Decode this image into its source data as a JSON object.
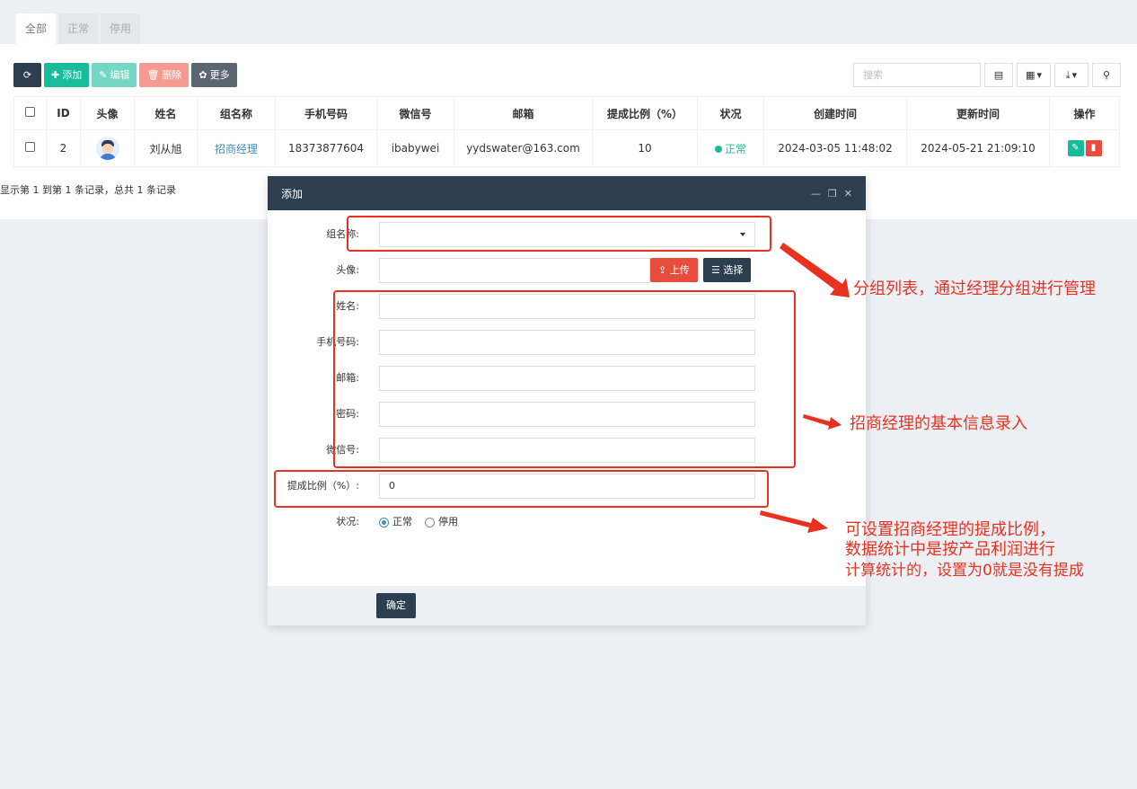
{
  "tabs": [
    {
      "label": "全部",
      "active": true
    },
    {
      "label": "正常",
      "active": false
    },
    {
      "label": "停用",
      "active": false
    }
  ],
  "toolbar": {
    "add": "添加",
    "edit": "编辑",
    "delete": "删除",
    "more": "更多",
    "search_placeholder": "搜索"
  },
  "table": {
    "headers": [
      "ID",
      "头像",
      "姓名",
      "组名称",
      "手机号码",
      "微信号",
      "邮箱",
      "提成比例（%）",
      "状况",
      "创建时间",
      "更新时间",
      "操作"
    ],
    "rows": [
      {
        "id": "2",
        "name": "刘从旭",
        "group": "招商经理",
        "phone": "18373877604",
        "wechat": "ibabywei",
        "email": "yydswater@163.com",
        "commission": "10",
        "status": "正常",
        "created": "2024-03-05 11:48:02",
        "updated": "2024-05-21 21:09:10"
      }
    ],
    "page_info": "显示第 1 到第 1 条记录，总共 1 条记录"
  },
  "modal": {
    "title": "添加",
    "fields": {
      "group_label": "组名称:",
      "avatar_label": "头像:",
      "upload": "上传",
      "choose": "选择",
      "name_label": "姓名:",
      "phone_label": "手机号码:",
      "email_label": "邮箱:",
      "password_label": "密码:",
      "wechat_label": "微信号:",
      "commission_label": "提成比例（%）:",
      "commission_value": "0",
      "status_label": "状况:",
      "status_normal": "正常",
      "status_disabled": "停用"
    },
    "ok": "确定"
  },
  "annotations": {
    "group_note": "分组列表，通过经理分组进行管理",
    "info_note": "招商经理的基本信息录入",
    "commission_note_1": "可设置招商经理的提成比例，",
    "commission_note_2": "数据统计中是按产品利润进行",
    "commission_note_3": "计算统计的，设置为0就是没有提成"
  },
  "colors": {
    "accent_dark": "#2c3e50",
    "success": "#18bc9c",
    "danger": "#e74c3c",
    "annotation_red": "#e8321f"
  }
}
